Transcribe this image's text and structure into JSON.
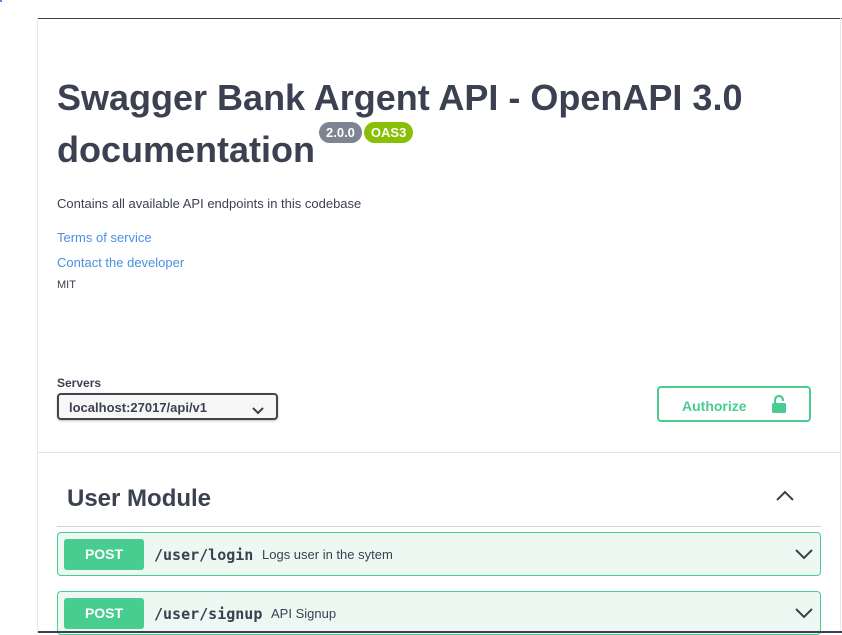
{
  "info": {
    "title": "Swagger Bank Argent API - OpenAPI 3.0 documentation",
    "version_badge": "2.0.0",
    "oas_badge": "OAS3",
    "description": "Contains all available API endpoints in this codebase",
    "terms_link": "Terms of service",
    "contact_link": "Contact the developer",
    "license": "MIT"
  },
  "servers": {
    "label": "Servers",
    "selected": "localhost:27017/api/v1"
  },
  "authorize": {
    "label": "Authorize"
  },
  "tag": {
    "name": "User Module",
    "operations": [
      {
        "method": "POST",
        "path": "/user/login",
        "summary": "Logs user in the sytem"
      },
      {
        "method": "POST",
        "path": "/user/signup",
        "summary": "API Signup"
      }
    ]
  },
  "colors": {
    "post": "#49cc90",
    "link": "#4990e2",
    "text": "#3b4151",
    "version_badge": "#7d8492",
    "oas_badge": "#89bf04"
  },
  "icons": {
    "select": "chevron-down-icon",
    "authorize": "lock-icon",
    "tag_toggle": "chevron-up-icon",
    "operation_toggle": "chevron-down-icon"
  }
}
